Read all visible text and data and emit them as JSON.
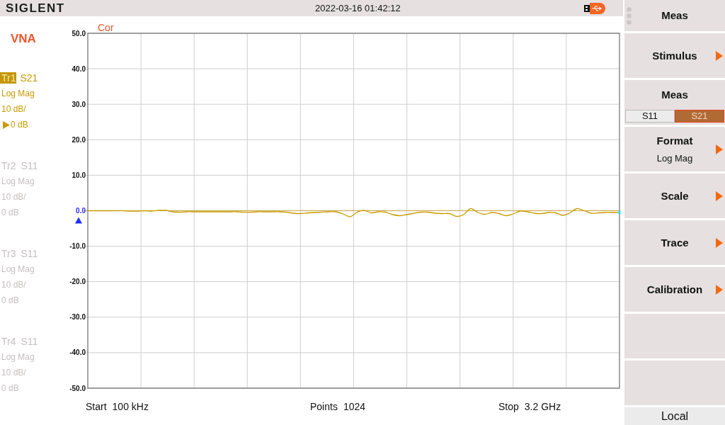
{
  "header": {
    "logo": "SIGLENT",
    "datetime": "2022-03-16 01:42:12"
  },
  "mode": "VNA",
  "traces": [
    {
      "label": "Tr1",
      "parameter": "S21",
      "format": "Log Mag",
      "scale": "10 dB/",
      "reference": "0 dB",
      "selected": true
    },
    {
      "label": "Tr2",
      "parameter": "S11",
      "format": "Log Mag",
      "scale": "10 dB/",
      "reference": "0 dB",
      "selected": false
    },
    {
      "label": "Tr3",
      "parameter": "S11",
      "format": "Log Mag",
      "scale": "10 dB/",
      "reference": "0 dB",
      "selected": false
    },
    {
      "label": "Tr4",
      "parameter": "S11",
      "format": "Log Mag",
      "scale": "10 dB/",
      "reference": "0 dB",
      "selected": false
    }
  ],
  "plot": {
    "status": "Cor",
    "chart_data": {
      "type": "line",
      "categories": [
        null,
        null,
        null,
        null,
        null,
        null,
        null,
        null,
        null,
        null,
        null,
        null,
        null,
        null,
        null,
        null,
        null,
        null,
        null,
        null,
        null,
        null,
        null,
        null,
        null,
        null,
        null,
        null,
        null,
        null,
        null,
        null,
        null,
        null,
        null,
        null,
        null,
        null,
        null,
        null,
        null,
        null,
        null,
        null,
        null,
        null,
        null,
        null,
        null,
        null,
        null,
        null,
        null,
        null,
        null,
        null,
        null,
        null,
        null,
        null,
        null,
        null,
        null,
        null,
        null,
        null,
        null,
        null,
        null,
        null,
        null,
        null,
        null,
        null,
        null,
        null
      ],
      "series": [
        {
          "color": "#c89b00",
          "values": [
            0,
            0,
            0,
            0,
            0,
            0,
            -0.1,
            -0.1,
            0,
            -0.1,
            0.1,
            0.1,
            -0.3,
            -0.4,
            -0.3,
            -0.3,
            -0.3,
            -0.3,
            -0.3,
            -0.3,
            -0.3,
            -0.3,
            -0.4,
            -0.4,
            -0.3,
            -0.3,
            -0.3,
            -0.3,
            -0.4,
            -0.7,
            -0.8,
            -0.6,
            -0.5,
            -0.4,
            -0.3,
            -0.3,
            -0.9,
            -1.7,
            -0.4,
            0.1,
            -0.6,
            -0.3,
            -0.4,
            -1.1,
            -1.4,
            -1.1,
            -0.7,
            -0.4,
            -0.4,
            -0.7,
            -0.8,
            -0.8,
            -1.6,
            -1.1,
            0.6,
            -0.5,
            -1.0,
            -0.5,
            -0.8,
            -1.4,
            -0.9,
            -0.1,
            -0.3,
            -0.7,
            -0.8,
            -0.5,
            -0.6,
            -1.3,
            -0.6,
            0.6,
            0.0,
            -0.7,
            -0.6,
            -0.5,
            -0.5,
            -0.5
          ]
        }
      ],
      "ylim": [
        -50,
        50
      ],
      "yticks": [
        {
          "value": 50,
          "label": "50.0"
        },
        {
          "value": 40,
          "label": "40.0"
        },
        {
          "value": 30,
          "label": "30.0"
        },
        {
          "value": 20,
          "label": "20.0"
        },
        {
          "value": 10,
          "label": "10.0"
        },
        {
          "value": 0,
          "label": "0.0"
        },
        {
          "value": -10,
          "label": "-10.0"
        },
        {
          "value": -20,
          "label": "-20.0"
        },
        {
          "value": -30,
          "label": "-30.0"
        },
        {
          "value": -40,
          "label": "-40.0"
        },
        {
          "value": -50,
          "label": "-50.0"
        }
      ],
      "grid": true,
      "ref_lines": [
        {
          "axis": "y",
          "value": 0
        }
      ]
    }
  },
  "sweep": [
    {
      "label": "Start",
      "value": "100 kHz"
    },
    {
      "label": "Points",
      "value": "1024"
    },
    {
      "label": "Stop",
      "value": "3.2 GHz"
    }
  ],
  "softkeys": [
    {
      "kind": "title",
      "label": "Meas"
    },
    {
      "kind": "submenu",
      "label": "Stimulus"
    },
    {
      "kind": "toggle",
      "label": "Meas",
      "options": [
        {
          "label": "S11",
          "selected": false
        },
        {
          "label": "S21",
          "selected": true
        }
      ]
    },
    {
      "kind": "submenu",
      "label": "Format",
      "value": "Log Mag"
    },
    {
      "kind": "submenu",
      "label": "Scale"
    },
    {
      "kind": "submenu",
      "label": "Trace"
    },
    {
      "kind": "submenu",
      "label": "Calibration"
    },
    {
      "kind": "empty"
    },
    {
      "kind": "empty"
    },
    {
      "kind": "local",
      "label": "Local"
    }
  ]
}
